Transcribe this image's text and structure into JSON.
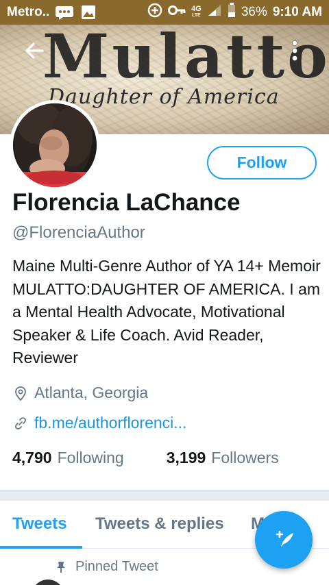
{
  "status_bar": {
    "carrier": "Metro..",
    "network": "4G",
    "network_sub": "LTE",
    "battery": "36%",
    "time": "9:10 AM",
    "icons": [
      "message-icon",
      "image-icon",
      "data-saver-icon",
      "key-icon",
      "lte-icon",
      "signal-icon",
      "battery-icon"
    ]
  },
  "banner": {
    "title": "Mulatto",
    "subtitle": "Daughter of America"
  },
  "profile": {
    "display_name": "Florencia LaChance",
    "handle": "@FlorenciaAuthor",
    "bio": "Maine Multi-Genre Author of YA 14+ Memoir MULATTO:DAUGHTER OF AMERICA.  I am a Mental Health Advocate, Motivational Speaker & Life Coach. Avid Reader, Reviewer",
    "location": "Atlanta, Georgia",
    "link": "fb.me/authorflorenci...",
    "following_count": "4,790",
    "following_label": "Following",
    "followers_count": "3,199",
    "followers_label": "Followers"
  },
  "follow_button": {
    "label": "Follow"
  },
  "tabs": [
    {
      "label": "Tweets",
      "active": true
    },
    {
      "label": "Tweets & replies",
      "active": false
    },
    {
      "label": "M",
      "active": false
    }
  ],
  "pinned": {
    "label": "Pinned Tweet"
  },
  "colors": {
    "accent": "#1da1f2",
    "link": "#1b95e0",
    "secondary_text": "#657786",
    "status_bar": "#8a6a2c"
  }
}
